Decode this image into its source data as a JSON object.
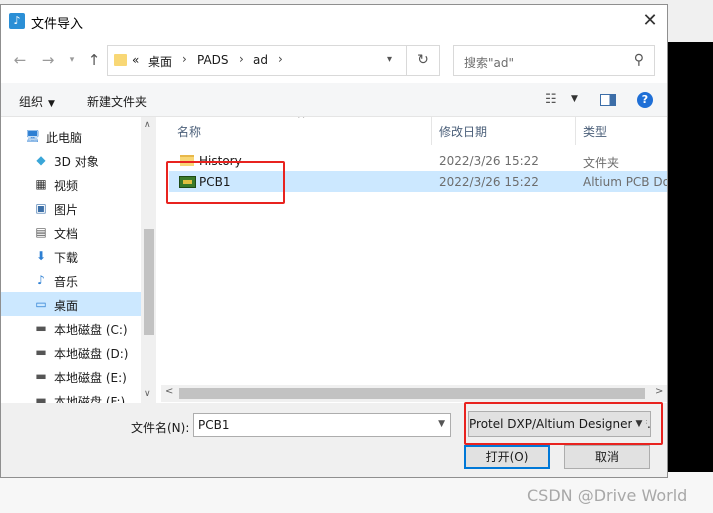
{
  "window": {
    "title": "文件导入",
    "title_icon": "import-file-icon"
  },
  "address": {
    "overflow": "«",
    "crumbs": [
      "桌面",
      "PADS",
      "ad"
    ],
    "search_placeholder": "搜索\"ad\""
  },
  "commands": {
    "organize": "组织",
    "new_folder": "新建文件夹"
  },
  "nav": {
    "items": [
      {
        "label": "此电脑",
        "icon": "computer-icon",
        "selected": false
      },
      {
        "label": "3D 对象",
        "icon": "cube-icon",
        "selected": false
      },
      {
        "label": "视频",
        "icon": "video-icon",
        "selected": false
      },
      {
        "label": "图片",
        "icon": "picture-icon",
        "selected": false
      },
      {
        "label": "文档",
        "icon": "document-icon",
        "selected": false
      },
      {
        "label": "下载",
        "icon": "download-icon",
        "selected": false
      },
      {
        "label": "音乐",
        "icon": "music-icon",
        "selected": false
      },
      {
        "label": "桌面",
        "icon": "desktop-icon",
        "selected": true
      },
      {
        "label": "本地磁盘 (C:)",
        "icon": "drive-icon",
        "selected": false
      },
      {
        "label": "本地磁盘 (D:)",
        "icon": "drive-icon",
        "selected": false
      },
      {
        "label": "本地磁盘 (E:)",
        "icon": "drive-icon",
        "selected": false
      },
      {
        "label": "本地磁盘 (F:)",
        "icon": "drive-icon",
        "selected": false
      }
    ]
  },
  "files": {
    "columns": [
      "名称",
      "修改日期",
      "类型"
    ],
    "rows": [
      {
        "name": "History",
        "date": "2022/3/26 15:22",
        "type": "文件夹",
        "icon": "folder-icon",
        "selected": false
      },
      {
        "name": "PCB1",
        "date": "2022/3/26 15:22",
        "type": "Altium PCB Document",
        "icon": "pcb-file-icon",
        "selected": true
      }
    ]
  },
  "bottom": {
    "filename_label": "文件名(N):",
    "filename_value": "PCB1",
    "filetype_value": "Protel DXP/Altium Designer (*.pcbdoc)",
    "open_label": "打开(O)",
    "cancel_label": "取消"
  },
  "watermark": "CSDN @Drive World",
  "colors": {
    "selection": "#cce8ff",
    "annotation": "#e8231f",
    "primary_button_border": "#0078d7"
  }
}
